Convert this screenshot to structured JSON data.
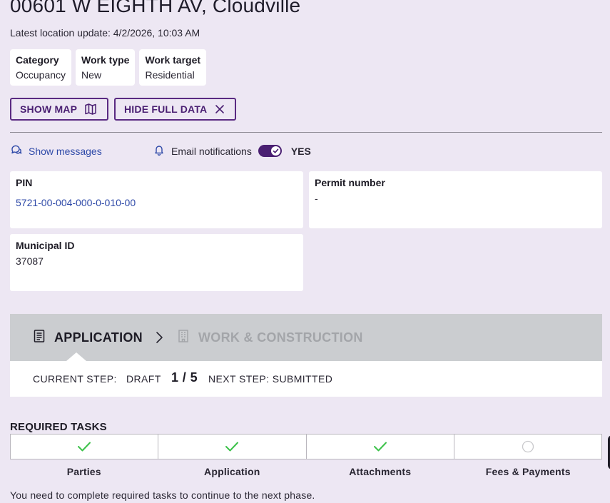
{
  "header": {
    "title": "00601 W EIGHTH AV, Cloudville",
    "subtitle": "Latest location update: 4/2/2026, 10:03 AM"
  },
  "chips": [
    {
      "label": "Category",
      "value": "Occupancy"
    },
    {
      "label": "Work type",
      "value": "New"
    },
    {
      "label": "Work target",
      "value": "Residential"
    }
  ],
  "actions": {
    "show_map": "SHOW MAP",
    "hide_full_data": "HIDE FULL DATA"
  },
  "messages": {
    "show_messages": "Show messages",
    "email_notifications": "Email notifications",
    "email_state": "YES"
  },
  "details": {
    "pin_label": "PIN",
    "pin_value": "5721-00-004-000-0-010-00",
    "permit_label": "Permit number",
    "permit_value": "-",
    "municipal_label": "Municipal ID",
    "municipal_value": "37087"
  },
  "phases": {
    "application": "APPLICATION",
    "work": "WORK & CONSTRUCTION"
  },
  "step": {
    "current_label": "CURRENT STEP:",
    "current_value": "DRAFT",
    "count": "1 / 5",
    "next": "NEXT STEP: SUBMITTED"
  },
  "required": {
    "title": "REQUIRED TASKS",
    "tasks": [
      {
        "label": "Parties",
        "status": "complete"
      },
      {
        "label": "Application",
        "status": "complete"
      },
      {
        "label": "Attachments",
        "status": "complete"
      },
      {
        "label": "Fees & Payments",
        "status": "pending"
      }
    ],
    "note": "You need to complete required tasks to continue to the next phase."
  },
  "colors": {
    "accent": "#4a1f72",
    "link": "#2f4aa8",
    "check": "#3cc24a",
    "background": "#ede7f3"
  }
}
